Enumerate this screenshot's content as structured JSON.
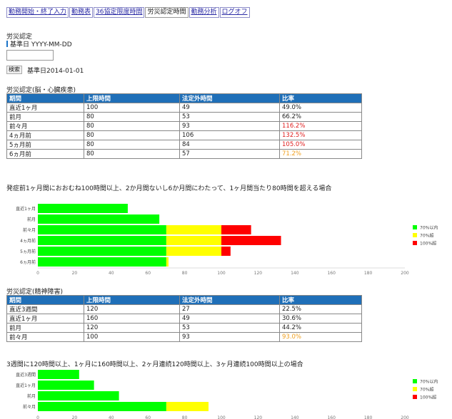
{
  "nav": {
    "tabs": [
      {
        "label": "勤務開始・終了入力"
      },
      {
        "label": "勤務表"
      },
      {
        "label": "36協定限度時間"
      },
      {
        "label": "労災認定時間",
        "active": true
      },
      {
        "label": "勤務分析"
      },
      {
        "label": "ログオフ"
      }
    ]
  },
  "page": {
    "section_title": "労災認定",
    "ref_date_label": "基準日 YYYY-MM-DD",
    "date_input_value": "",
    "search_button": "検索",
    "ref_date_value": "基準日2014-01-01"
  },
  "colors": {
    "under70": "#00ff00",
    "over70": "#ffff00",
    "over100": "#ff0000",
    "table_header": "#1f6fb8",
    "text_red": "#e02020",
    "text_orange": "#f0a020"
  },
  "section1": {
    "title": "労災認定(脳・心臓疾患)",
    "headers": [
      "期間",
      "上限時間",
      "法定外時間",
      "比率"
    ],
    "rows": [
      [
        "直近1ヶ月",
        "100",
        "49",
        "49.0%"
      ],
      [
        "前月",
        "80",
        "53",
        "66.2%"
      ],
      [
        "前々月",
        "80",
        "93",
        "116.2%"
      ],
      [
        "4ヵ月前",
        "80",
        "106",
        "132.5%"
      ],
      [
        "5ヵ月前",
        "80",
        "84",
        "105.0%"
      ],
      [
        "6ヵ月前",
        "80",
        "57",
        "71.2%"
      ]
    ],
    "ratio_styles": [
      "",
      "",
      "red",
      "red",
      "red",
      "orange"
    ],
    "condition": "発症前1ヶ月間におおむね100時間以上、2か月間ないし6か月間にわたって、1ヶ月間当たり80時間を超える場合"
  },
  "section2": {
    "title": "労災認定(精神障害)",
    "headers": [
      "期間",
      "上限時間",
      "法定外時間",
      "比率"
    ],
    "rows": [
      [
        "直近3週間",
        "120",
        "27",
        "22.5%"
      ],
      [
        "直近1ヶ月",
        "160",
        "49",
        "30.6%"
      ],
      [
        "前月",
        "120",
        "53",
        "44.2%"
      ],
      [
        "前々月",
        "100",
        "93",
        "93.0%"
      ]
    ],
    "ratio_styles": [
      "",
      "",
      "",
      "orange"
    ],
    "condition": "3週間に120時間以上、1ヶ月に160時間以上、2ヶ月連続120時間以上、3ヶ月連続100時間以上の場合"
  },
  "chart_data": [
    {
      "type": "bar",
      "orientation": "horizontal",
      "stacked": true,
      "categories": [
        "直近1ヶ月",
        "前月",
        "前々月",
        "4ヵ月前",
        "5ヵ月前",
        "6ヵ月前"
      ],
      "series": [
        {
          "name": "70%以内",
          "color": "#00ff00",
          "values": [
            49,
            66.2,
            70,
            70,
            70,
            70
          ]
        },
        {
          "name": "70%超",
          "color": "#ffff00",
          "values": [
            0,
            0,
            30,
            30,
            30,
            1.2
          ]
        },
        {
          "name": "100%超",
          "color": "#ff0000",
          "values": [
            0,
            0,
            16.2,
            32.5,
            5,
            0
          ]
        }
      ],
      "xlim": [
        0,
        200
      ],
      "xticks": [
        0,
        20,
        40,
        60,
        80,
        100,
        120,
        140,
        160,
        180,
        200
      ],
      "legend": "right"
    },
    {
      "type": "bar",
      "orientation": "horizontal",
      "stacked": true,
      "categories": [
        "直近3週間",
        "直近1ヶ月",
        "前月",
        "前々月"
      ],
      "series": [
        {
          "name": "70%以内",
          "color": "#00ff00",
          "values": [
            22.5,
            30.6,
            44.2,
            70
          ]
        },
        {
          "name": "70%超",
          "color": "#ffff00",
          "values": [
            0,
            0,
            0,
            23
          ]
        },
        {
          "name": "100%超",
          "color": "#ff0000",
          "values": [
            0,
            0,
            0,
            0
          ]
        }
      ],
      "xlim": [
        0,
        200
      ],
      "xticks": [
        0,
        20,
        40,
        60,
        80,
        100,
        120,
        140,
        160,
        180,
        200
      ],
      "legend": "right"
    }
  ]
}
